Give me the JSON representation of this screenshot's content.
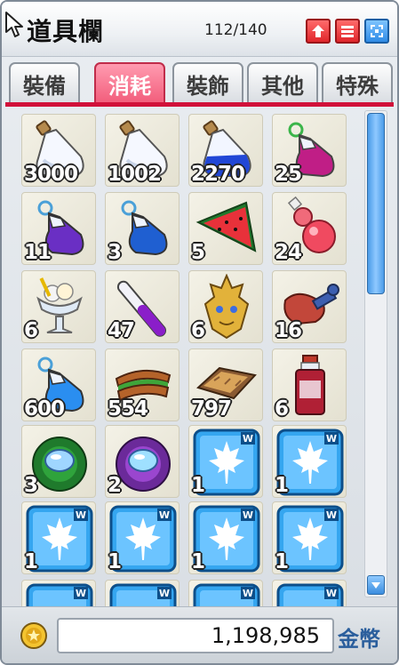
{
  "window": {
    "title": "道具欄",
    "slot_count": "112/140",
    "buttons": [
      "expand-icon",
      "sort-icon",
      "collapse-icon"
    ]
  },
  "tabs": [
    {
      "label": "裝備",
      "active": false
    },
    {
      "label": "消耗",
      "active": true
    },
    {
      "label": "裝飾",
      "active": false
    },
    {
      "label": "其他",
      "active": false
    },
    {
      "label": "特殊",
      "active": false
    }
  ],
  "items": [
    {
      "icon": "white-potion-icon",
      "qty": "3000"
    },
    {
      "icon": "white-potion-icon",
      "qty": "1002"
    },
    {
      "icon": "blue-potion-icon",
      "qty": "2270"
    },
    {
      "icon": "elixir-icon",
      "qty": "25"
    },
    {
      "icon": "purple-potion-icon",
      "qty": "11"
    },
    {
      "icon": "blue-elixir-icon",
      "qty": "3"
    },
    {
      "icon": "watermelon-icon",
      "qty": "5"
    },
    {
      "icon": "red-gourd-icon",
      "qty": "24"
    },
    {
      "icon": "ice-cream-parfait-icon",
      "qty": "6"
    },
    {
      "icon": "purple-vial-icon",
      "qty": "47"
    },
    {
      "icon": "golden-mask-icon",
      "qty": "6"
    },
    {
      "icon": "meat-bone-icon",
      "qty": "16"
    },
    {
      "icon": "blue-elixir-icon",
      "qty": "600"
    },
    {
      "icon": "sandwich-icon",
      "qty": "554"
    },
    {
      "icon": "bread-icon",
      "qty": "797"
    },
    {
      "icon": "juice-bottle-icon",
      "qty": "6"
    },
    {
      "icon": "green-nest-orb-icon",
      "qty": "3"
    },
    {
      "icon": "purple-nest-orb-icon",
      "qty": "2"
    },
    {
      "icon": "maple-leaf-card-icon",
      "qty": "1"
    },
    {
      "icon": "maple-leaf-card-icon",
      "qty": "1"
    },
    {
      "icon": "maple-leaf-card-icon",
      "qty": "1"
    },
    {
      "icon": "maple-leaf-card-icon",
      "qty": "1"
    },
    {
      "icon": "maple-leaf-card-icon",
      "qty": "1"
    },
    {
      "icon": "maple-leaf-card-icon",
      "qty": "1"
    },
    {
      "icon": "maple-leaf-card-icon",
      "qty": ""
    },
    {
      "icon": "maple-leaf-card-icon",
      "qty": ""
    },
    {
      "icon": "maple-leaf-card-icon",
      "qty": ""
    },
    {
      "icon": "maple-leaf-card-icon",
      "qty": ""
    }
  ],
  "footer": {
    "meso_amount": "1,198,985",
    "meso_label": "金幣",
    "coin_icon": "gold-coin-icon"
  },
  "colors": {
    "active_tab": "#f25d7b",
    "tab_rule": "#d1113a",
    "scroll": "#4a9be8"
  }
}
